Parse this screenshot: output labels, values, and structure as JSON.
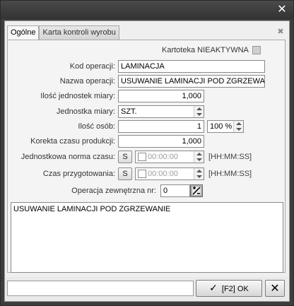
{
  "window": {
    "close_glyph": "✕"
  },
  "tabs": [
    {
      "label": "Ogólne",
      "active": true
    },
    {
      "label": "Karta kontroli wyrobu",
      "active": false
    }
  ],
  "tab_close_glyph": "✖",
  "kartoteka": {
    "label": "Kartoteka NIEAKTYWNA",
    "checked": false
  },
  "fields": {
    "kod_operacji": {
      "label": "Kod operacji:",
      "value": "LAMINACJA"
    },
    "nazwa_operacji": {
      "label": "Nazwa operacji:",
      "value": "USUWANIE LAMINACJI POD ZGRZEWANIE"
    },
    "ilosc_jednostek": {
      "label": "Ilość jednostek miary:",
      "value": "1,000"
    },
    "jednostka_miary": {
      "label": "Jednostka miary:",
      "value": "SZT."
    },
    "ilosc_osob": {
      "label": "Ilość osób:",
      "value": "1",
      "percent": "100 %"
    },
    "korekta_czasu": {
      "label": "Korekta czasu produkcji:",
      "value": "1,000"
    },
    "norma_czasu": {
      "label": "Jednostkowa norma czasu:",
      "s_label": "S",
      "value": "00:00:00",
      "unit": "[HH:MM:SS]"
    },
    "czas_przygotowania": {
      "label": "Czas przygotowania:",
      "s_label": "S",
      "value": "00:00:00",
      "unit": "[HH:MM:SS]"
    },
    "operacja_zewnetrzna": {
      "label": "Operacja zewnętrzna nr:",
      "value": "0"
    }
  },
  "memo": {
    "text": "USUWANIE LAMINACJI POD ZGRZEWANIE"
  },
  "footer": {
    "ok_label": "[F2] OK",
    "ok_icon": "✓",
    "cancel_icon": "✕"
  }
}
